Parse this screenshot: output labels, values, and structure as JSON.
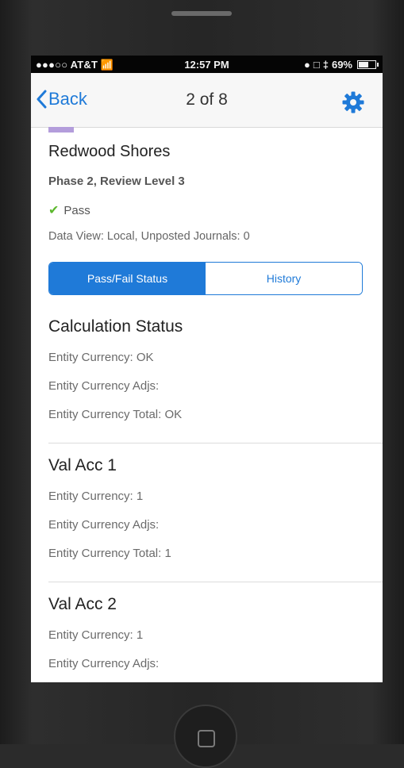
{
  "status_bar": {
    "carrier": "●●●○○ AT&T ",
    "time": "12:57 PM",
    "battery": "69%",
    "battery_level": 0.69
  },
  "nav": {
    "back_label": "Back",
    "title": "2 of 8"
  },
  "entity": {
    "name": "Redwood Shores",
    "phase": "Phase 2, Review Level 3",
    "status": "Pass",
    "data_view": "Data View: Local, Unposted Journals: 0",
    "color_chip": "#b39ddb"
  },
  "segments": {
    "active": "Pass/Fail Status",
    "inactive": "History"
  },
  "sections": [
    {
      "heading": "Calculation Status",
      "lines": [
        "Entity Currency: OK",
        "Entity Currency Adjs:",
        "Entity Currency Total: OK"
      ]
    },
    {
      "heading": "Val Acc 1",
      "lines": [
        "Entity Currency: 1",
        "Entity Currency Adjs:",
        "Entity Currency Total: 1"
      ]
    },
    {
      "heading": "Val Acc 2",
      "lines": [
        "Entity Currency: 1",
        "Entity Currency Adjs:"
      ]
    }
  ],
  "colors": {
    "accent": "#1f7ad8",
    "pass": "#5cb82d"
  }
}
